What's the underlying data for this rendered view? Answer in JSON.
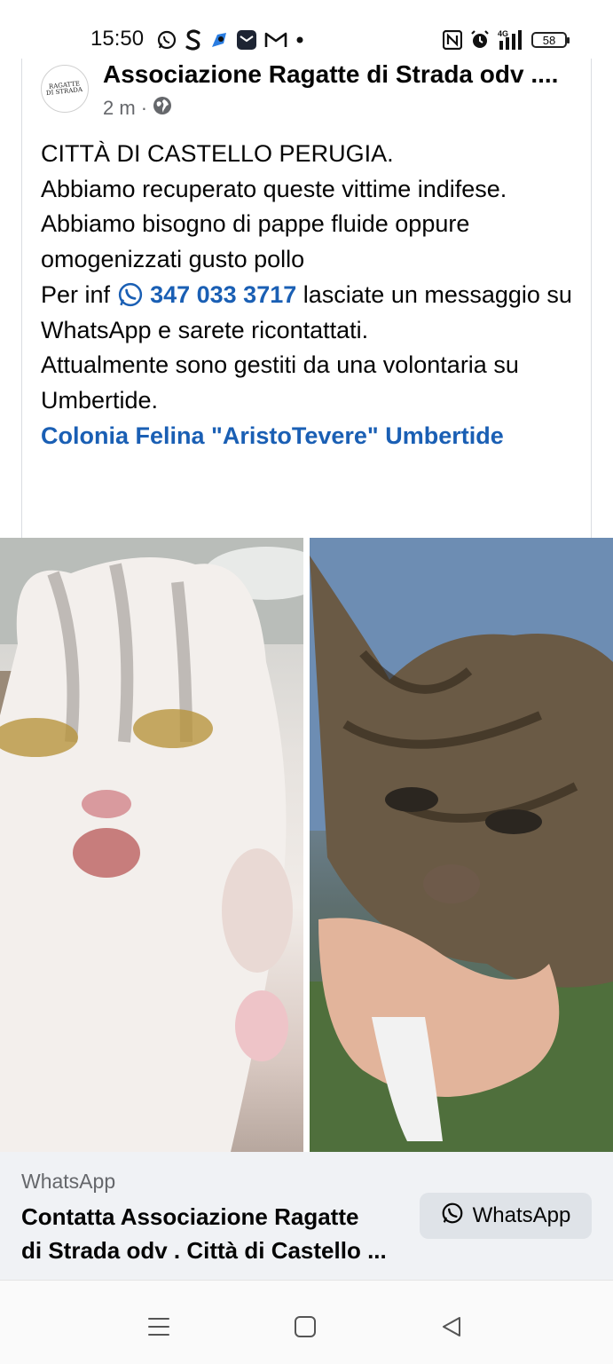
{
  "status_bar": {
    "time": "15:50",
    "left_icons": [
      "whatsapp-icon",
      "s-app-icon",
      "blue-app-icon",
      "mail-app-icon",
      "gmail-icon",
      "dot-icon"
    ],
    "right_icons": [
      "nfc-icon",
      "alarm-icon",
      "signal-4g-icon",
      "battery-icon"
    ],
    "network": "4G",
    "battery": "58"
  },
  "post": {
    "page_name": "Associazione Ragatte di Strada odv ....",
    "avatar_text_line1": "RAGATTE",
    "avatar_text_line2": "DI STRADA",
    "time_ago": "2 m",
    "separator": "·",
    "visibility_icon": "globe-icon",
    "lines": {
      "l1": "CITTÀ DI CASTELLO PERUGIA.",
      "l2": "Abbiamo recuperato queste vittime indifese.",
      "l3": "Abbiamo bisogno di pappe fluide oppure omogenizzati gusto pollo",
      "l4_prefix": "Per inf",
      "phone": "347 033 3717",
      "l4_suffix": "lasciate un messaggio su WhatsApp e sarete ricontattati.",
      "l5": "Attualmente sono gestiti da una volontaria su Umbertide.",
      "link": "Colonia Felina \"AristoTevere\" Umbertide"
    }
  },
  "photos": [
    {
      "name": "photo-kitten-white"
    },
    {
      "name": "photo-kitten-tabby"
    }
  ],
  "link_preview": {
    "source": "WhatsApp",
    "title_line1": "Contatta Associazione Ragatte",
    "title_line2": "di Strada odv . Città di Castello ...",
    "button_label": "WhatsApp",
    "button_icon": "whatsapp-icon"
  },
  "nav_bar": {
    "buttons": [
      "menu-icon",
      "home-icon",
      "back-icon"
    ]
  },
  "colors": {
    "link": "#1a5fb4",
    "text": "#050505",
    "secondary": "#65676b",
    "preview_bg": "#f0f2f5",
    "button_bg": "#dfe3e8"
  }
}
